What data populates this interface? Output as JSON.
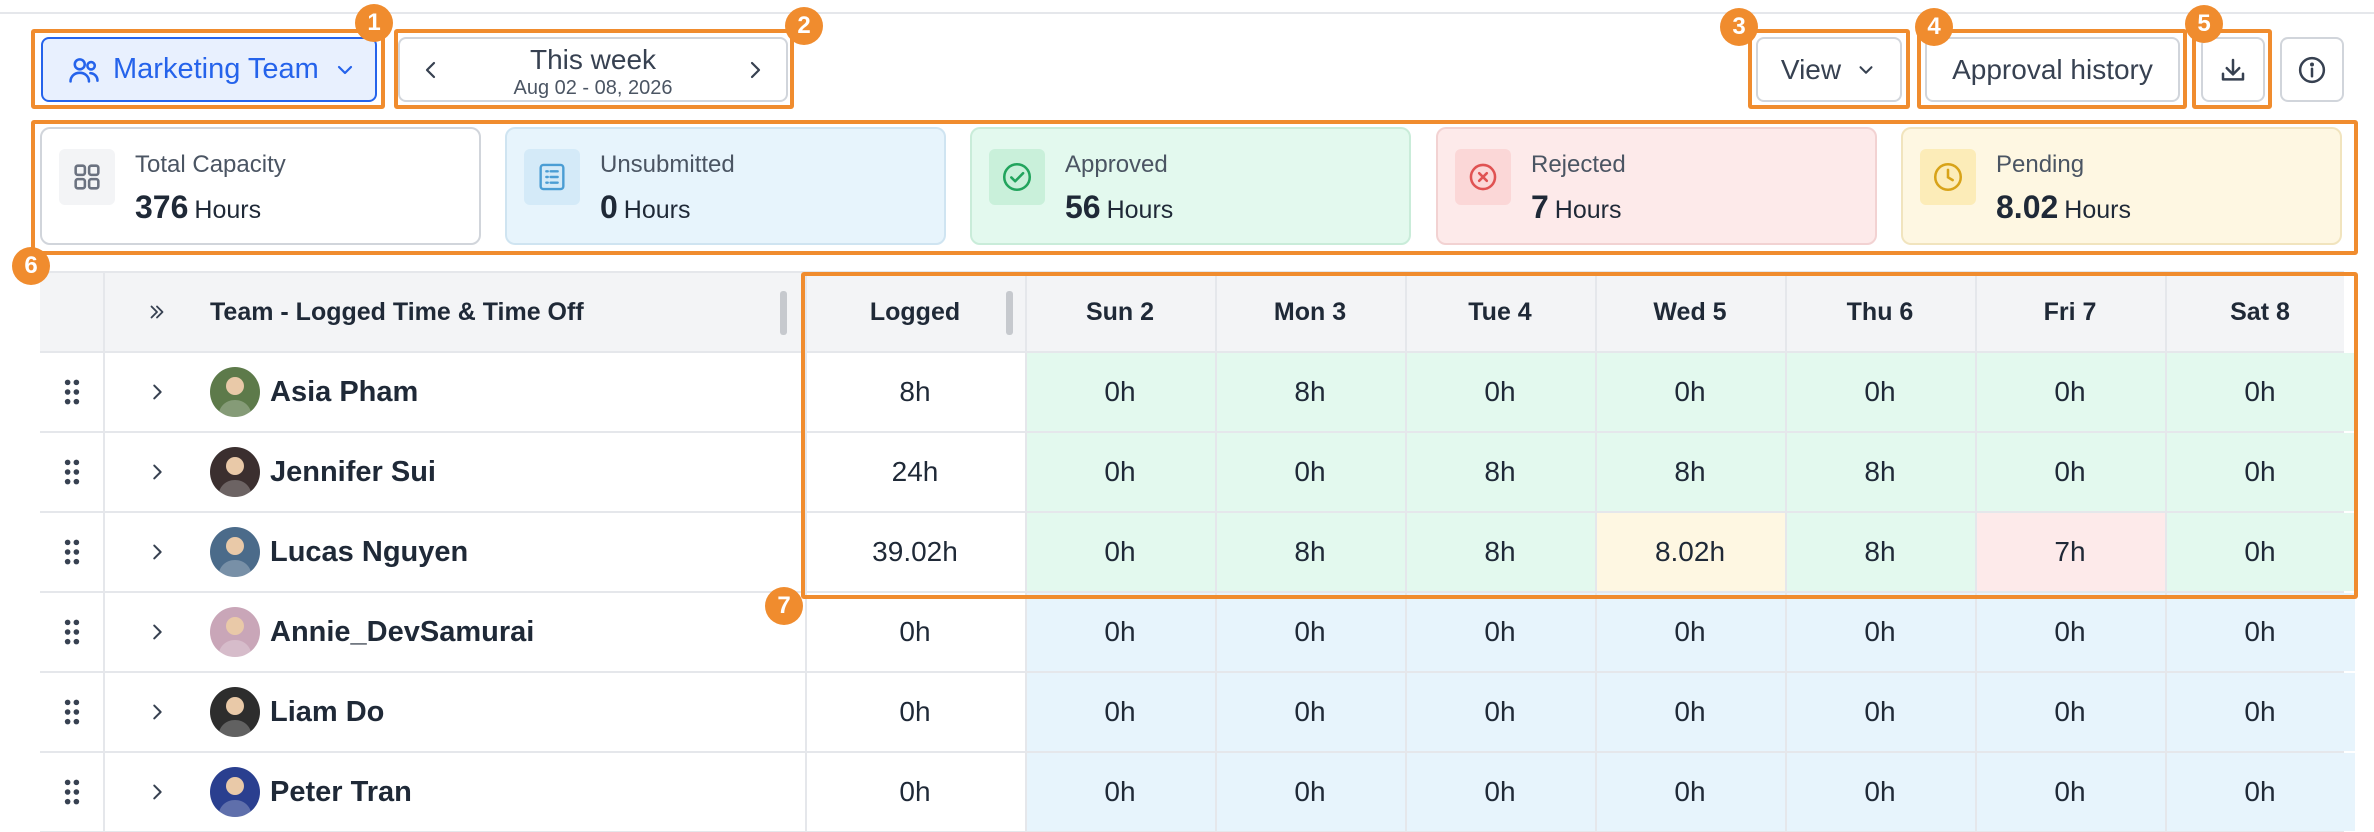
{
  "toolbar": {
    "team_label": "Marketing Team",
    "week_title": "This week",
    "week_range": "Aug 02 - 08, 2026",
    "view_label": "View",
    "approval_label": "Approval history"
  },
  "summary": [
    {
      "label": "Total Capacity",
      "value": "376",
      "unit": "Hours",
      "icon": "grid-icon",
      "bg": "#ffffff",
      "border": "#d1d5db",
      "icon_bg": "#f3f4f6",
      "icon_color": "#6b7280"
    },
    {
      "label": "Unsubmitted",
      "value": "0",
      "unit": "Hours",
      "icon": "list-icon",
      "bg": "#e7f4fc",
      "border": "#cfe4f1",
      "icon_bg": "#d4eaf8",
      "icon_color": "#4a9dd4"
    },
    {
      "label": "Approved",
      "value": "56",
      "unit": "Hours",
      "icon": "check-circle-icon",
      "bg": "#e3f9ee",
      "border": "#c9ecd9",
      "icon_bg": "#c9f0da",
      "icon_color": "#22a45d"
    },
    {
      "label": "Rejected",
      "value": "7",
      "unit": "Hours",
      "icon": "x-circle-icon",
      "bg": "#fdeaea",
      "border": "#f2d2d2",
      "icon_bg": "#fbd7d7",
      "icon_color": "#e05252"
    },
    {
      "label": "Pending",
      "value": "8.02",
      "unit": "Hours",
      "icon": "clock-icon",
      "bg": "#fef7e2",
      "border": "#f1e4be",
      "icon_bg": "#fcecb8",
      "icon_color": "#d8a318"
    }
  ],
  "table": {
    "team_header": "Team - Logged Time & Time Off",
    "logged_header": "Logged",
    "days": [
      "Sun 2",
      "Mon 3",
      "Tue 4",
      "Wed 5",
      "Thu 6",
      "Fri 7",
      "Sat 8"
    ],
    "rows": [
      {
        "name": "Asia Pham",
        "logged": "8h",
        "hours": [
          "0h",
          "8h",
          "0h",
          "0h",
          "0h",
          "0h",
          "0h"
        ],
        "status": [
          "approved",
          "approved",
          "approved",
          "approved",
          "approved",
          "approved",
          "approved"
        ],
        "avatar_color": "#5d7a4a"
      },
      {
        "name": "Jennifer Sui",
        "logged": "24h",
        "hours": [
          "0h",
          "0h",
          "8h",
          "8h",
          "8h",
          "0h",
          "0h"
        ],
        "status": [
          "approved",
          "approved",
          "approved",
          "approved",
          "approved",
          "approved",
          "approved"
        ],
        "avatar_color": "#3b2f2f"
      },
      {
        "name": "Lucas Nguyen",
        "logged": "39.02h",
        "hours": [
          "0h",
          "8h",
          "8h",
          "8.02h",
          "8h",
          "7h",
          "0h"
        ],
        "status": [
          "approved",
          "approved",
          "approved",
          "pending",
          "approved",
          "rejected",
          "approved"
        ],
        "avatar_color": "#4b6b8a"
      },
      {
        "name": "Annie_DevSamurai",
        "logged": "0h",
        "hours": [
          "0h",
          "0h",
          "0h",
          "0h",
          "0h",
          "0h",
          "0h"
        ],
        "status": [
          "unsubmitted",
          "unsubmitted",
          "unsubmitted",
          "unsubmitted",
          "unsubmitted",
          "unsubmitted",
          "unsubmitted"
        ],
        "avatar_color": "#c9a6b8"
      },
      {
        "name": "Liam Do",
        "logged": "0h",
        "hours": [
          "0h",
          "0h",
          "0h",
          "0h",
          "0h",
          "0h",
          "0h"
        ],
        "status": [
          "unsubmitted",
          "unsubmitted",
          "unsubmitted",
          "unsubmitted",
          "unsubmitted",
          "unsubmitted",
          "unsubmitted"
        ],
        "avatar_color": "#2d2d2d"
      },
      {
        "name": "Peter Tran",
        "logged": "0h",
        "hours": [
          "0h",
          "0h",
          "0h",
          "0h",
          "0h",
          "0h",
          "0h"
        ],
        "status": [
          "unsubmitted",
          "unsubmitted",
          "unsubmitted",
          "unsubmitted",
          "unsubmitted",
          "unsubmitted",
          "unsubmitted"
        ],
        "avatar_color": "#2a3f8f"
      }
    ]
  },
  "status_colors": {
    "approved": "#e3f9ee",
    "pending": "#fef7e2",
    "rejected": "#fdeaea",
    "unsubmitted": "#e7f4fc"
  },
  "callouts": [
    "1",
    "2",
    "3",
    "4",
    "5",
    "6",
    "7"
  ],
  "accent": "#2563eb",
  "callout_color": "#f08c2e"
}
